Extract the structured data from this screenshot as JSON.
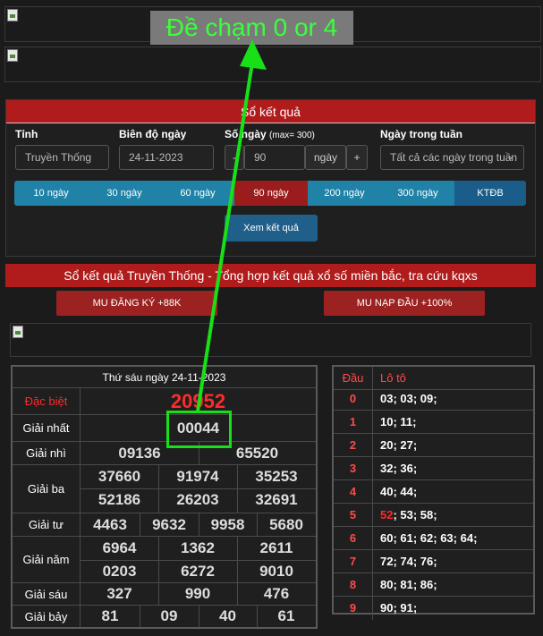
{
  "annotation": {
    "text": "Đề chạm 0 or 4",
    "color": "#3cff3c"
  },
  "search_panel": {
    "title": "Sổ kết quả",
    "province_label": "Tỉnh",
    "province_value": "Truyền Thống",
    "range_label": "Biên độ ngày",
    "range_value": "24-11-2023",
    "days_label": "Số ngày",
    "days_hint": "(max= 300)",
    "days_minus": "-",
    "days_value": "90",
    "days_unit": "ngày",
    "days_plus": "+",
    "weekday_label": "Ngày trong tuần",
    "weekday_value": "Tất cả các ngày trong tuần",
    "tabs": [
      "10 ngày",
      "30 ngày",
      "60 ngày",
      "90 ngày",
      "200 ngày",
      "300 ngày",
      "KTĐB"
    ],
    "active_tab": "90 ngày",
    "view_button": "Xem kết quả"
  },
  "banner": {
    "title": "Sổ kết quả Truyền Thống - Tổng hợp kết quả xổ số miền bắc, tra cứu kqxs",
    "promo_left": "MU ĐĂNG KÝ +88K",
    "promo_right": "MU NẠP ĐẦU +100%"
  },
  "results": {
    "header": "Thứ sáu ngày 24-11-2023",
    "labels": {
      "db": "Đặc biệt",
      "g1": "Giải nhất",
      "g2": "Giải nhì",
      "g3": "Giải ba",
      "g4": "Giải tư",
      "g5": "Giải năm",
      "g6": "Giải sáu",
      "g7": "Giải bảy"
    },
    "db": "20952",
    "g1": "00044",
    "g2": [
      "09136",
      "65520"
    ],
    "g3": [
      "37660",
      "91974",
      "35253",
      "52186",
      "26203",
      "32691"
    ],
    "g4": [
      "4463",
      "9632",
      "9958",
      "5680"
    ],
    "g5": [
      "6964",
      "1362",
      "2611",
      "0203",
      "6272",
      "9010"
    ],
    "g6": [
      "327",
      "990",
      "476"
    ],
    "g7": [
      "81",
      "09",
      "40",
      "61"
    ]
  },
  "loto": {
    "head_dau": "Đầu",
    "head_loto": "Lô tô",
    "rows": [
      {
        "dau": "0",
        "vals": "03; 03; 09;"
      },
      {
        "dau": "1",
        "vals": "10; 11;"
      },
      {
        "dau": "2",
        "vals": "20; 27;"
      },
      {
        "dau": "3",
        "vals": "32; 36;"
      },
      {
        "dau": "4",
        "vals": "40; 44;"
      },
      {
        "dau": "5",
        "hl": "52",
        "vals": "; 53; 58;"
      },
      {
        "dau": "6",
        "vals": "60; 61; 62; 63; 64;"
      },
      {
        "dau": "7",
        "vals": "72; 74; 76;"
      },
      {
        "dau": "8",
        "vals": "80; 81; 86;"
      },
      {
        "dau": "9",
        "vals": "90; 91;"
      }
    ]
  },
  "colors": {
    "red_bar": "#b01c1c",
    "tab_blue": "#1f82a6",
    "highlight_green": "#18e018"
  }
}
